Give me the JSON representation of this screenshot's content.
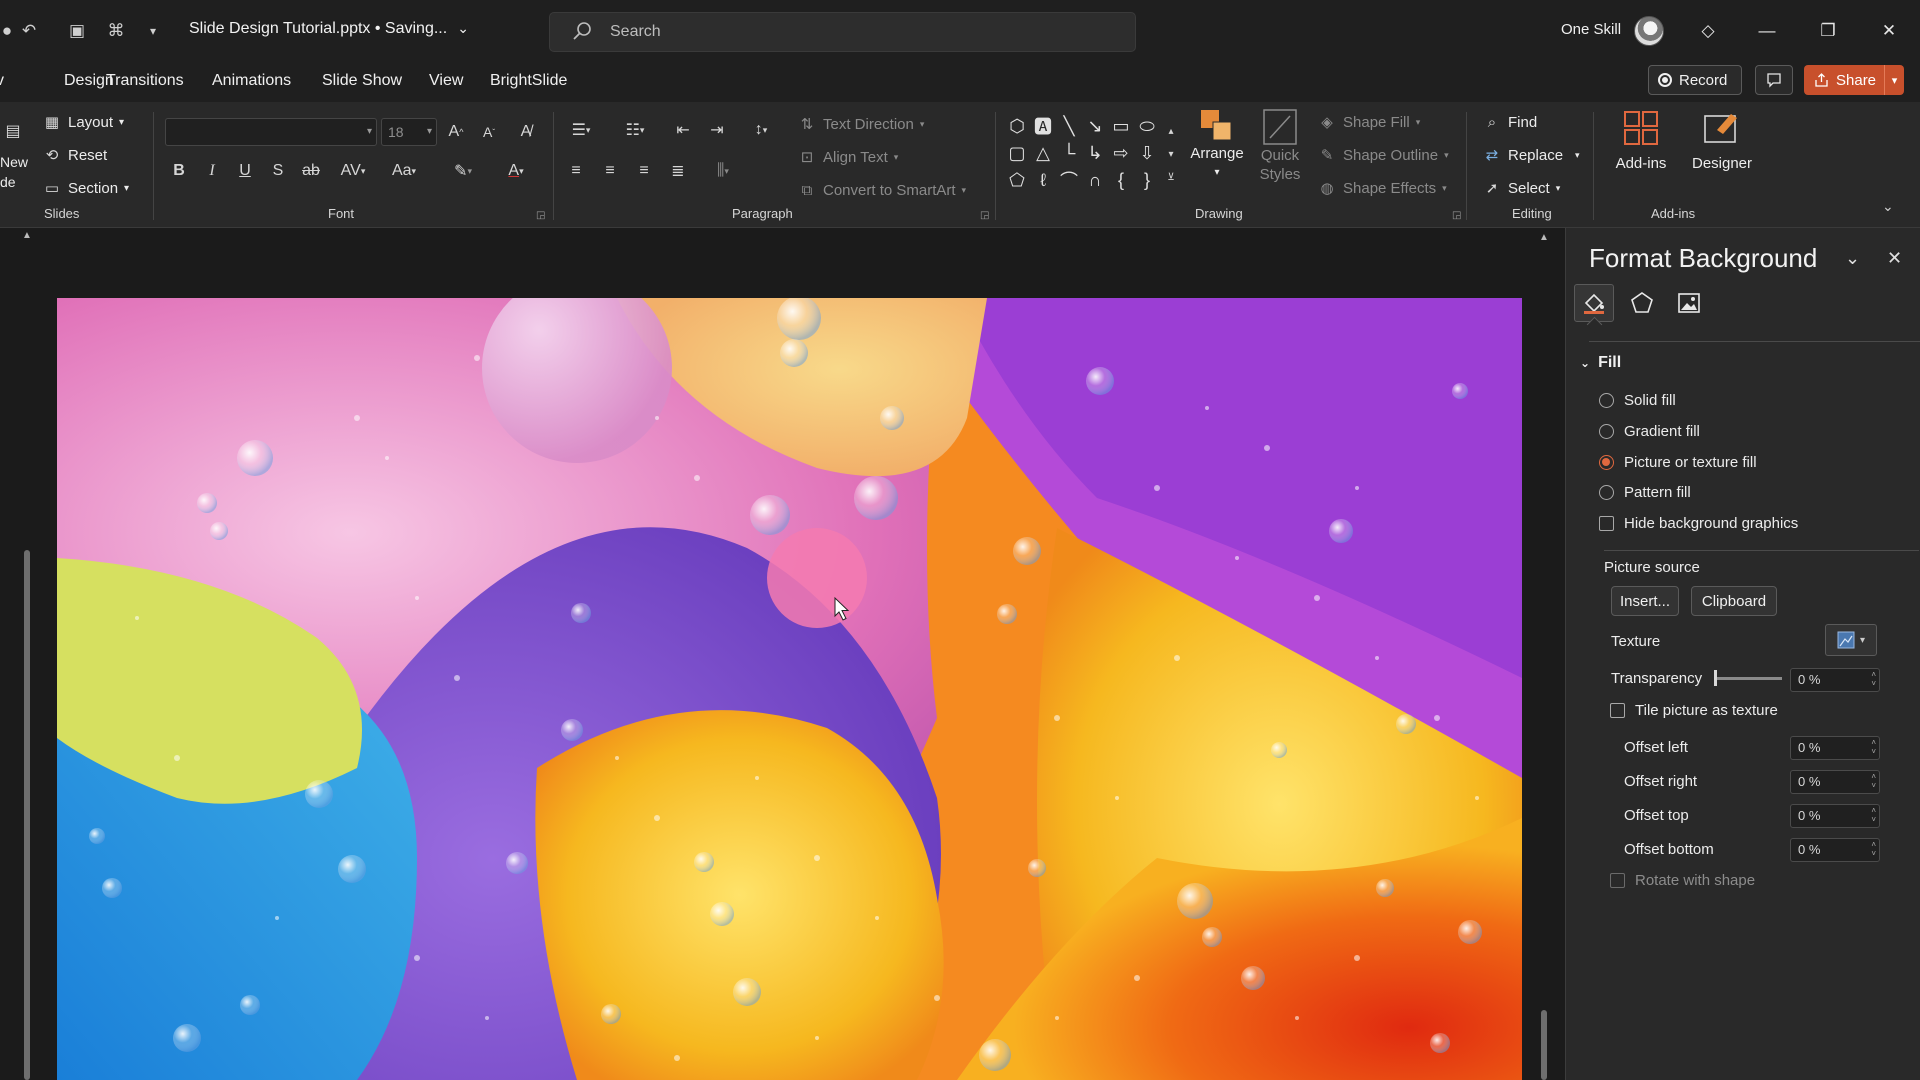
{
  "titlebar": {
    "doc_title": "Slide Design Tutorial.pptx • Saving...",
    "search_placeholder": "Search",
    "user_name": "One Skill"
  },
  "tabs": [
    "Design",
    "Transitions",
    "Animations",
    "Slide Show",
    "View",
    "BrightSlide"
  ],
  "tab_partial_left": "v",
  "actions": {
    "record": "Record",
    "share": "Share"
  },
  "ribbon": {
    "slides": {
      "new_slide_line1": "New",
      "new_slide_line2": "de",
      "layout": "Layout",
      "reset": "Reset",
      "section": "Section",
      "label": "Slides"
    },
    "font": {
      "name": "",
      "size": "18",
      "label": "Font"
    },
    "paragraph": {
      "text_direction": "Text Direction",
      "align_text": "Align Text",
      "convert_smartart": "Convert to SmartArt",
      "label": "Paragraph"
    },
    "drawing": {
      "arrange": "Arrange",
      "quick_styles_line1": "Quick",
      "quick_styles_line2": "Styles",
      "shape_fill": "Shape Fill",
      "shape_outline": "Shape Outline",
      "shape_effects": "Shape Effects",
      "label": "Drawing"
    },
    "editing": {
      "find": "Find",
      "replace": "Replace",
      "select": "Select",
      "label": "Editing"
    },
    "addins": {
      "addins_btn": "Add-ins",
      "designer": "Designer",
      "label": "Add-ins"
    }
  },
  "pane": {
    "title": "Format Background",
    "section": "Fill",
    "options": [
      {
        "label": "Solid fill",
        "selected": false
      },
      {
        "label": "Gradient fill",
        "selected": false
      },
      {
        "label": "Picture or texture fill",
        "selected": true
      },
      {
        "label": "Pattern fill",
        "selected": false
      }
    ],
    "hide_graphics": "Hide background graphics",
    "picture_source": "Picture source",
    "insert": "Insert...",
    "clipboard": "Clipboard",
    "texture": "Texture",
    "transparency": "Transparency",
    "transparency_value": "0 %",
    "transparency_level": 0,
    "tile": "Tile picture as texture",
    "offsets": [
      {
        "label": "Offset left",
        "value": "0 %"
      },
      {
        "label": "Offset right",
        "value": "0 %"
      },
      {
        "label": "Offset top",
        "value": "0 %"
      },
      {
        "label": "Offset bottom",
        "value": "0 %"
      }
    ],
    "rotate": "Rotate with shape"
  },
  "colors": {
    "accent": "#c8502c",
    "radio_selected": "#e0683f"
  }
}
